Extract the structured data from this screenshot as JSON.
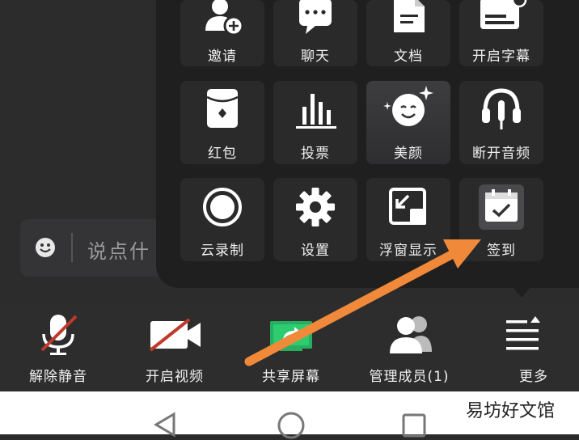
{
  "colors": {
    "accent_arrow": "#f08a3a",
    "panel_bg": "#1f1f20",
    "tile_bg": "#2a2a2b",
    "share_green": "#27ae60",
    "mute_slash": "#c0392b"
  },
  "chat": {
    "placeholder": "说点什",
    "icon": "smile-icon"
  },
  "panel": {
    "tiles": [
      {
        "label": "邀请",
        "icon": "invite-user-icon"
      },
      {
        "label": "聊天",
        "icon": "chat-bubble-icon"
      },
      {
        "label": "文档",
        "icon": "document-icon"
      },
      {
        "label": "开启字幕",
        "icon": "caption-icon"
      },
      {
        "label": "红包",
        "icon": "red-packet-icon"
      },
      {
        "label": "投票",
        "icon": "vote-bars-icon"
      },
      {
        "label": "美颜",
        "icon": "beauty-face-icon"
      },
      {
        "label": "断开音频",
        "icon": "headset-icon"
      },
      {
        "label": "云录制",
        "icon": "record-icon"
      },
      {
        "label": "设置",
        "icon": "gear-icon"
      },
      {
        "label": "浮窗显示",
        "icon": "float-window-icon"
      },
      {
        "label": "签到",
        "icon": "calendar-check-icon"
      }
    ]
  },
  "toolbar": {
    "items": [
      {
        "label": "解除静音",
        "icon": "mic-muted-icon"
      },
      {
        "label": "开启视频",
        "icon": "video-off-icon"
      },
      {
        "label": "共享屏幕",
        "icon": "share-screen-icon"
      },
      {
        "label": "管理成员(1)",
        "icon": "members-icon"
      },
      {
        "label": "更多",
        "icon": "more-menu-icon"
      }
    ]
  },
  "watermark": "易坊好文馆",
  "nav": {
    "back": "back-icon",
    "home": "home-icon",
    "recents": "recents-icon"
  }
}
